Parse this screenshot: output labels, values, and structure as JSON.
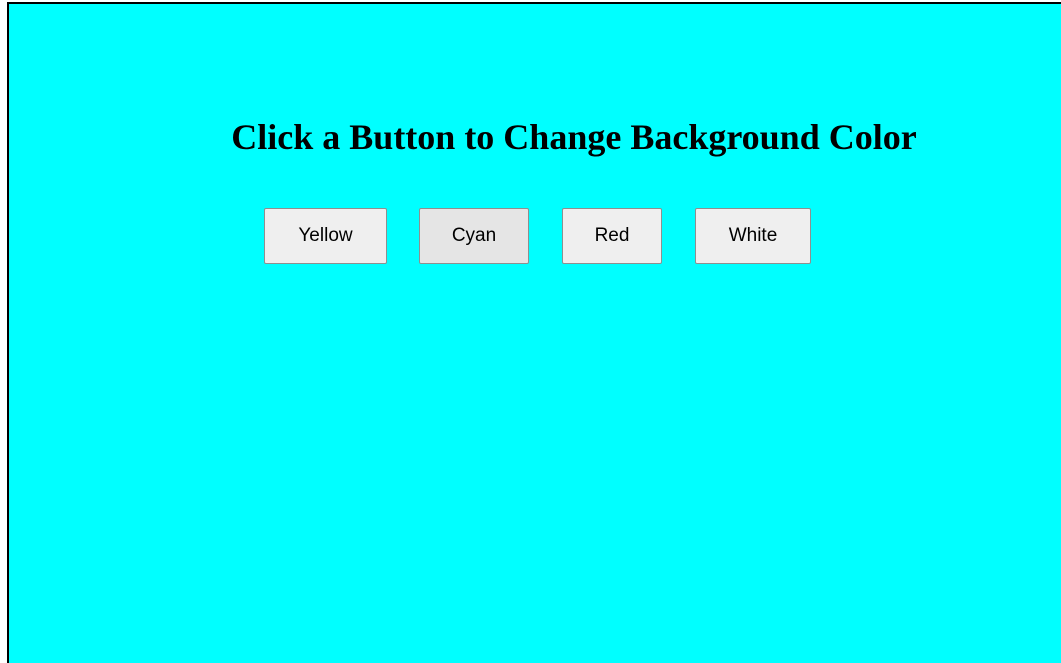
{
  "page": {
    "title": "Click a Button to Change Background Color",
    "background_color": "#00ffff"
  },
  "buttons": [
    {
      "label": "Yellow",
      "color": "#ffff00"
    },
    {
      "label": "Cyan",
      "color": "#00ffff",
      "active": true
    },
    {
      "label": "Red",
      "color": "#ff0000"
    },
    {
      "label": "White",
      "color": "#ffffff"
    }
  ]
}
